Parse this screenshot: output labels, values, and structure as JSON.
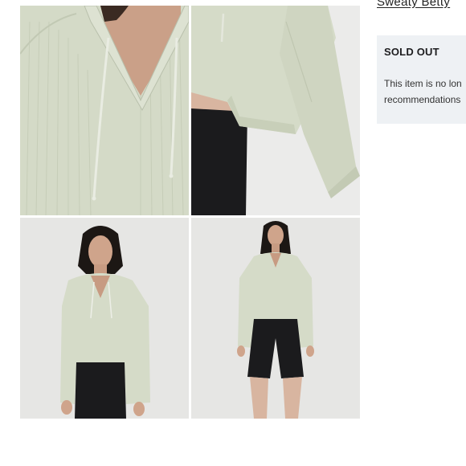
{
  "brand": {
    "link_text": "Sweaty Betty"
  },
  "product": {
    "status": "SOLD OUT",
    "message_line1": "This item is no lon",
    "message_line2": "recommendations"
  },
  "gallery": {
    "images": [
      {
        "name": "hoodie-neckline-closeup"
      },
      {
        "name": "hoodie-sleeve-hem-closeup"
      },
      {
        "name": "model-waist-up"
      },
      {
        "name": "model-full-body"
      }
    ]
  },
  "colors": {
    "sweater": "#d5dbc8",
    "shorts": "#1b1b1d",
    "background": "#e6e6e4",
    "panel": "#eef1f4"
  }
}
